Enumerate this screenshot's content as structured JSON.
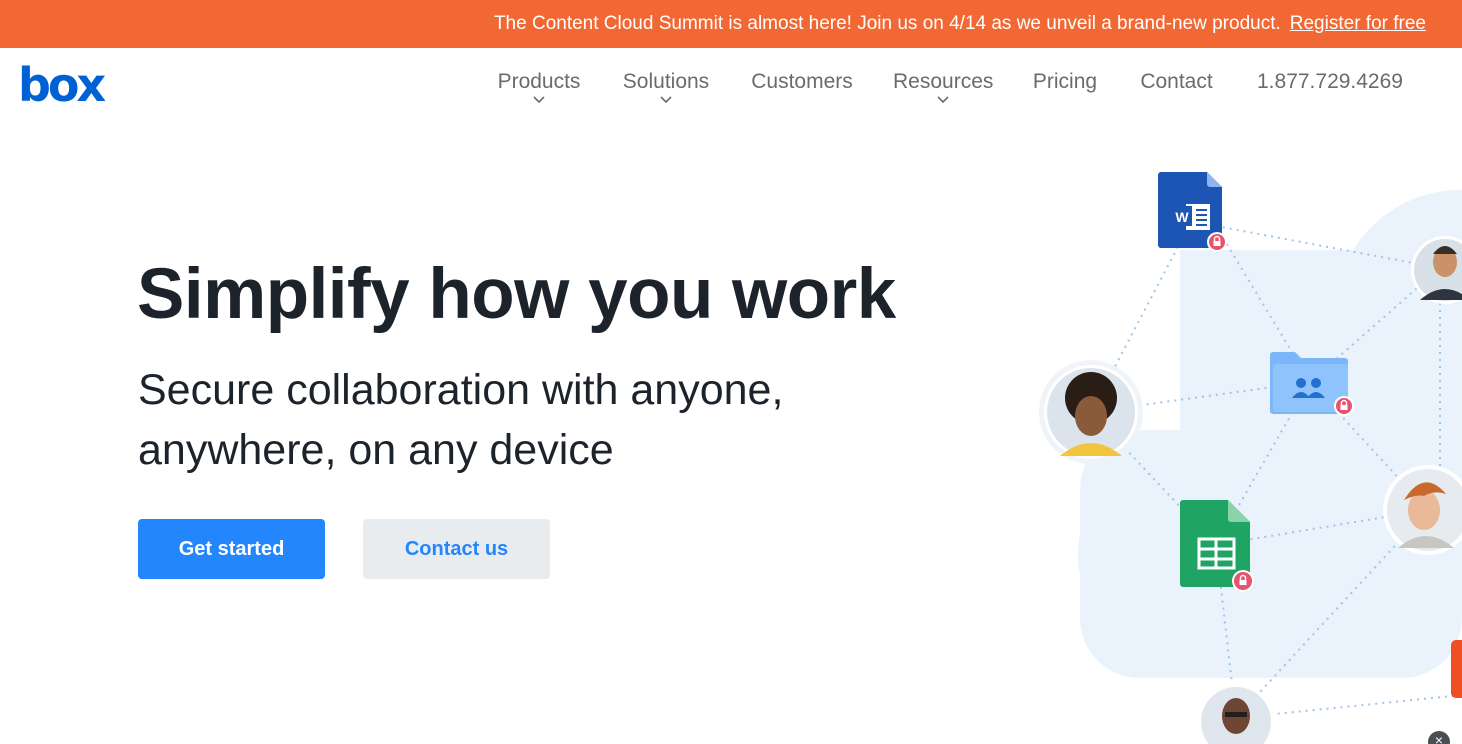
{
  "promo": {
    "text": "The Content Cloud Summit is almost here! Join us on 4/14 as we unveil a brand-new product.",
    "link": "Register for free"
  },
  "logo": {
    "text": "box",
    "color": "#0061d5"
  },
  "nav": {
    "products": "Products",
    "solutions": "Solutions",
    "customers": "Customers",
    "resources": "Resources",
    "pricing": "Pricing",
    "contact": "Contact",
    "phone": "1.877.729.4269"
  },
  "hero": {
    "title": "Simplify how you work",
    "subtitle_line1": "Secure collaboration with anyone,",
    "subtitle_line2": "anywhere, on any device",
    "primary_button": "Get started",
    "secondary_button": "Contact us"
  },
  "colors": {
    "promo_bg": "#f26835",
    "primary": "#2486fc",
    "secondary_bg": "#e9ecef",
    "text_dark": "#1c232b",
    "nav_text": "#6b6b6b"
  },
  "icons": [
    "chevron-down-icon",
    "word-doc-icon",
    "shared-folder-icon",
    "spreadsheet-icon",
    "lock-badge-icon",
    "close-icon"
  ],
  "close_glyph": "×"
}
